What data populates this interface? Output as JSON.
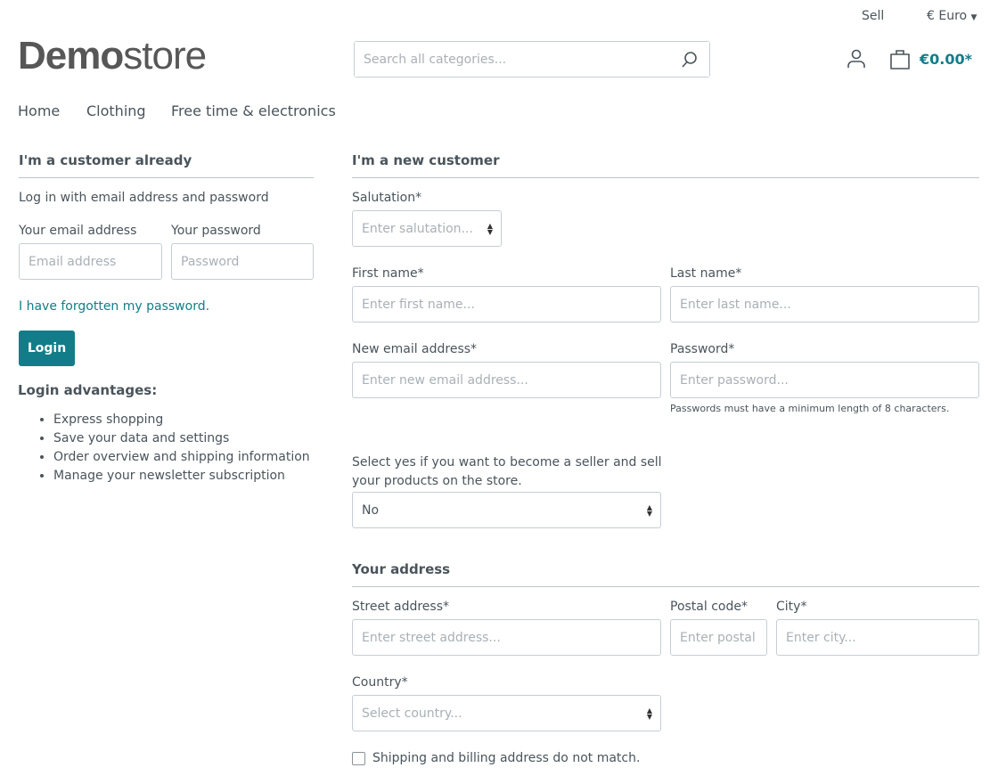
{
  "header": {
    "sell": "Sell",
    "currency": "€ Euro",
    "logo_bold": "Demo",
    "logo_light": "store",
    "search_placeholder": "Search all categories...",
    "cart_total": "€0.00*"
  },
  "nav": [
    "Home",
    "Clothing",
    "Free time & electronics"
  ],
  "login": {
    "title": "I'm a customer already",
    "intro": "Log in with email address and password",
    "email_label": "Your email address",
    "email_placeholder": "Email address",
    "password_label": "Your password",
    "password_placeholder": "Password",
    "forgot": "I have forgotten my password.",
    "button": "Login",
    "advantages_title": "Login advantages:",
    "advantages": [
      "Express shopping",
      "Save your data and settings",
      "Order overview and shipping information",
      "Manage your newsletter subscription"
    ]
  },
  "register": {
    "title": "I'm a new customer",
    "salutation_label": "Salutation*",
    "salutation_placeholder": "Enter salutation...",
    "first_label": "First name*",
    "first_placeholder": "Enter first name...",
    "last_label": "Last name*",
    "last_placeholder": "Enter last name...",
    "email_label": "New email address*",
    "email_placeholder": "Enter new email address...",
    "password_label": "Password*",
    "password_placeholder": "Enter password...",
    "password_hint": "Passwords must have a minimum length of 8 characters.",
    "seller_label": "Select yes if you want to become a seller and sell your products on the store.",
    "seller_value": "No"
  },
  "address": {
    "title": "Your address",
    "street_label": "Street address*",
    "street_placeholder": "Enter street address...",
    "postal_label": "Postal code*",
    "postal_placeholder": "Enter postal code...",
    "city_label": "City*",
    "city_placeholder": "Enter city...",
    "country_label": "Country*",
    "country_placeholder": "Select country...",
    "different_shipping": "Shipping and billing address do not match."
  },
  "colors": {
    "accent": "#127d88"
  }
}
